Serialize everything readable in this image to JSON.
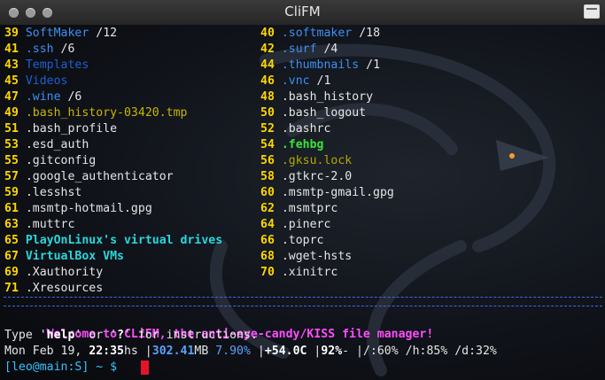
{
  "window": {
    "title": "CliFM"
  },
  "listing": {
    "left": [
      {
        "num": "39",
        "name": "SoftMaker",
        "suffix": " /12",
        "type": "dir"
      },
      {
        "num": "41",
        "name": ".ssh",
        "suffix": " /6",
        "type": "dir"
      },
      {
        "num": "43",
        "name": "Templates",
        "suffix": "",
        "type": "dirdim"
      },
      {
        "num": "45",
        "name": "Videos",
        "suffix": "",
        "type": "dirdim"
      },
      {
        "num": "47",
        "name": ".wine",
        "suffix": " /6",
        "type": "dir"
      },
      {
        "num": "49",
        "name": ".bash_history-03420.tmp",
        "suffix": "",
        "type": "tmp"
      },
      {
        "num": "51",
        "name": ".bash_profile",
        "suffix": "",
        "type": "file"
      },
      {
        "num": "53",
        "name": ".esd_auth",
        "suffix": "",
        "type": "file"
      },
      {
        "num": "55",
        "name": ".gitconfig",
        "suffix": "",
        "type": "file"
      },
      {
        "num": "57",
        "name": ".google_authenticator",
        "suffix": "",
        "type": "file"
      },
      {
        "num": "59",
        "name": ".lesshst",
        "suffix": "",
        "type": "file"
      },
      {
        "num": "61",
        "name": ".msmtp-hotmail.gpg",
        "suffix": "",
        "type": "file"
      },
      {
        "num": "63",
        "name": ".muttrc",
        "suffix": "",
        "type": "file"
      },
      {
        "num": "65",
        "name": "PlayOnLinux's virtual drives",
        "suffix": "",
        "type": "link"
      },
      {
        "num": "67",
        "name": "VirtualBox VMs",
        "suffix": "",
        "type": "link"
      },
      {
        "num": "69",
        "name": ".Xauthority",
        "suffix": "",
        "type": "file"
      },
      {
        "num": "71",
        "name": ".Xresources",
        "suffix": "",
        "type": "file"
      }
    ],
    "right": [
      {
        "num": "40",
        "name": ".softmaker",
        "suffix": " /18",
        "type": "dir"
      },
      {
        "num": "42",
        "name": ".surf",
        "suffix": " /4",
        "type": "dir"
      },
      {
        "num": "44",
        "name": ".thumbnails",
        "suffix": " /1",
        "type": "dir"
      },
      {
        "num": "46",
        "name": ".vnc",
        "suffix": " /1",
        "type": "dir"
      },
      {
        "num": "48",
        "name": ".bash_history",
        "suffix": "",
        "type": "file"
      },
      {
        "num": "50",
        "name": ".bash_logout",
        "suffix": "",
        "type": "file"
      },
      {
        "num": "52",
        "name": ".bashrc",
        "suffix": "",
        "type": "file"
      },
      {
        "num": "54",
        "name": ".fehbg",
        "suffix": "",
        "type": "hidden-exe"
      },
      {
        "num": "56",
        "name": ".gksu.lock",
        "suffix": "",
        "type": "dimfile"
      },
      {
        "num": "58",
        "name": ".gtkrc-2.0",
        "suffix": "",
        "type": "file"
      },
      {
        "num": "60",
        "name": ".msmtp-gmail.gpg",
        "suffix": "",
        "type": "file"
      },
      {
        "num": "62",
        "name": ".msmtprc",
        "suffix": "",
        "type": "file"
      },
      {
        "num": "64",
        "name": ".pinerc",
        "suffix": "",
        "type": "file"
      },
      {
        "num": "66",
        "name": ".toprc",
        "suffix": "",
        "type": "file"
      },
      {
        "num": "68",
        "name": ".wget-hsts",
        "suffix": "",
        "type": "file"
      },
      {
        "num": "70",
        "name": ".xinitrc",
        "suffix": "",
        "type": "file"
      }
    ]
  },
  "welcome": "Welcome to CLiFM, the anti-eye-candy/KISS file manager!",
  "help_line": {
    "pre": "Type '",
    "help": "help",
    "mid": "' or '",
    "q": "?",
    "post": "' for instructions."
  },
  "status": {
    "date": "Mon Feb 19, ",
    "time": "22:35",
    "time_suffix": "hs |",
    "mem": "302.41",
    "mem_unit": "MB ",
    "mem_pct": "7.90%",
    "sep1": " |",
    "temp": "+54.0C",
    "sep2": " |",
    "batt": "92%",
    "rest": "- |/:60% /h:85% /d:32%"
  },
  "prompt": {
    "text": "[leo@main:S] ~ $ "
  },
  "colors": {
    "accent_blue": "#3f8ff2",
    "number_yellow": "#ffd700",
    "link_cyan": "#28d8dc",
    "welcome_magenta": "#ff4dff",
    "cursor_red": "#e8132a"
  }
}
